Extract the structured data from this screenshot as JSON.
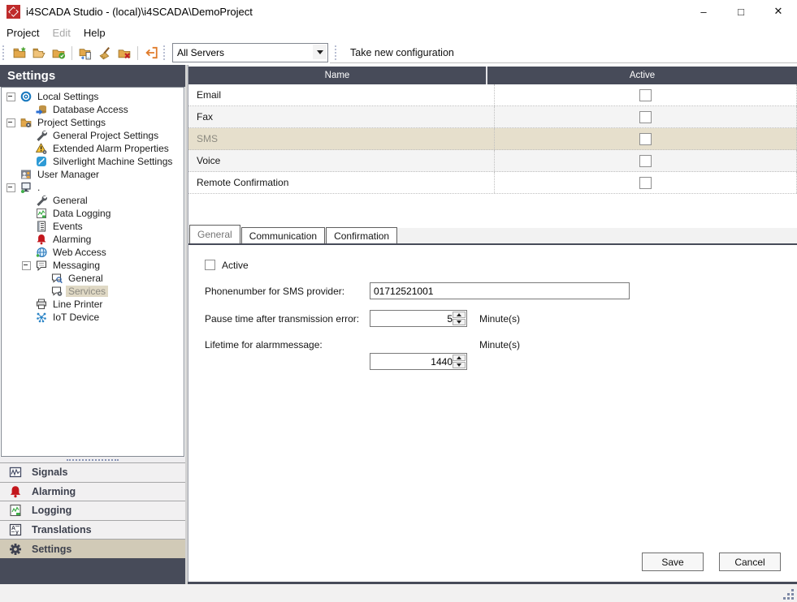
{
  "window": {
    "title": "i4SCADA Studio - (local)\\i4SCADA\\DemoProject"
  },
  "menu": {
    "items": [
      {
        "label": "Project",
        "enabled": true
      },
      {
        "label": "Edit",
        "enabled": false
      },
      {
        "label": "Help",
        "enabled": true
      }
    ]
  },
  "toolbar": {
    "icons": [
      "new-project",
      "open-project",
      "publish-project",
      "copy-to-device",
      "clean-project",
      "delete-project",
      "import"
    ],
    "server_select": "All Servers",
    "take_new_configuration": "Take new configuration"
  },
  "sidebar": {
    "title": "Settings",
    "tree": [
      {
        "label": "Local Settings",
        "level": 0,
        "expander": true,
        "icon": "gear-blue-icon",
        "selected": false
      },
      {
        "label": "Database Access",
        "level": 1,
        "expander": false,
        "icon": "database-icon",
        "selected": false
      },
      {
        "label": "Project Settings",
        "level": 0,
        "expander": true,
        "icon": "folder-gear-icon",
        "selected": false
      },
      {
        "label": "General Project Settings",
        "level": 1,
        "expander": false,
        "icon": "wrench-icon",
        "selected": false
      },
      {
        "label": "Extended Alarm Properties",
        "level": 1,
        "expander": false,
        "icon": "warning-gear-icon",
        "selected": false
      },
      {
        "label": "Silverlight Machine Settings",
        "level": 1,
        "expander": false,
        "icon": "silverlight-icon",
        "selected": false
      },
      {
        "label": "User Manager",
        "level": 0,
        "expander": false,
        "icon": "users-icon",
        "selected": false
      },
      {
        "label": ".",
        "level": 0,
        "expander": true,
        "icon": "computer-icon",
        "selected": false
      },
      {
        "label": "General",
        "level": 1,
        "expander": false,
        "icon": "wrench-icon",
        "selected": false
      },
      {
        "label": "Data Logging",
        "level": 1,
        "expander": false,
        "icon": "data-logging-icon",
        "selected": false
      },
      {
        "label": "Events",
        "level": 1,
        "expander": false,
        "icon": "events-icon",
        "selected": false
      },
      {
        "label": "Alarming",
        "level": 1,
        "expander": false,
        "icon": "bell-icon",
        "selected": false
      },
      {
        "label": "Web Access",
        "level": 1,
        "expander": false,
        "icon": "globe-icon",
        "selected": false
      },
      {
        "label": "Messaging",
        "level": 1,
        "expander": true,
        "icon": "message-icon",
        "selected": false
      },
      {
        "label": "General",
        "level": 2,
        "expander": false,
        "icon": "message-search-icon",
        "selected": false
      },
      {
        "label": "Services",
        "level": 2,
        "expander": false,
        "icon": "message-gear-icon",
        "selected": true
      },
      {
        "label": "Line Printer",
        "level": 1,
        "expander": false,
        "icon": "printer-icon",
        "selected": false
      },
      {
        "label": "IoT Device",
        "level": 1,
        "expander": false,
        "icon": "iot-icon",
        "selected": false
      }
    ],
    "nav": [
      {
        "label": "Signals",
        "icon": "signals-icon",
        "active": false
      },
      {
        "label": "Alarming",
        "icon": "bell-icon",
        "active": false
      },
      {
        "label": "Logging",
        "icon": "logging-icon",
        "active": false
      },
      {
        "label": "Translations",
        "icon": "translations-icon",
        "active": false
      },
      {
        "label": "Settings",
        "icon": "gear-icon",
        "active": true
      }
    ]
  },
  "table": {
    "columns": [
      "Name",
      "Active"
    ],
    "rows": [
      {
        "name": "Email",
        "active": false,
        "selected": false
      },
      {
        "name": "Fax",
        "active": false,
        "selected": false
      },
      {
        "name": "SMS",
        "active": false,
        "selected": true
      },
      {
        "name": "Voice",
        "active": false,
        "selected": false
      },
      {
        "name": "Remote Confirmation",
        "active": false,
        "selected": false
      }
    ]
  },
  "tabs": {
    "items": [
      {
        "label": "General",
        "active": true
      },
      {
        "label": "Communication",
        "active": false
      },
      {
        "label": "Confirmation",
        "active": false
      }
    ]
  },
  "form": {
    "active_label": "Active",
    "active_checked": false,
    "fields": [
      {
        "label": "Phonenumber for SMS provider:",
        "value": "01712521001",
        "unit": ""
      },
      {
        "label": "Pause time after transmission error:",
        "value": "5",
        "unit": "Minute(s)"
      },
      {
        "label": "Lifetime for alarmmessage:",
        "value": "1440",
        "unit": "Minute(s)"
      }
    ]
  },
  "actions": {
    "save": "Save",
    "cancel": "Cancel"
  },
  "colors": {
    "header_dark": "#474b59",
    "selection_tan": "#e6dfcc",
    "tree_selection_tan": "#e0d9c5",
    "nav_selection_tan": "#d1cab7",
    "alarm_red": "#c3161c",
    "app_icon_red": "#bf2b2b",
    "accent_blue": "#1878be",
    "folder_yellow": "#e3a84c"
  }
}
